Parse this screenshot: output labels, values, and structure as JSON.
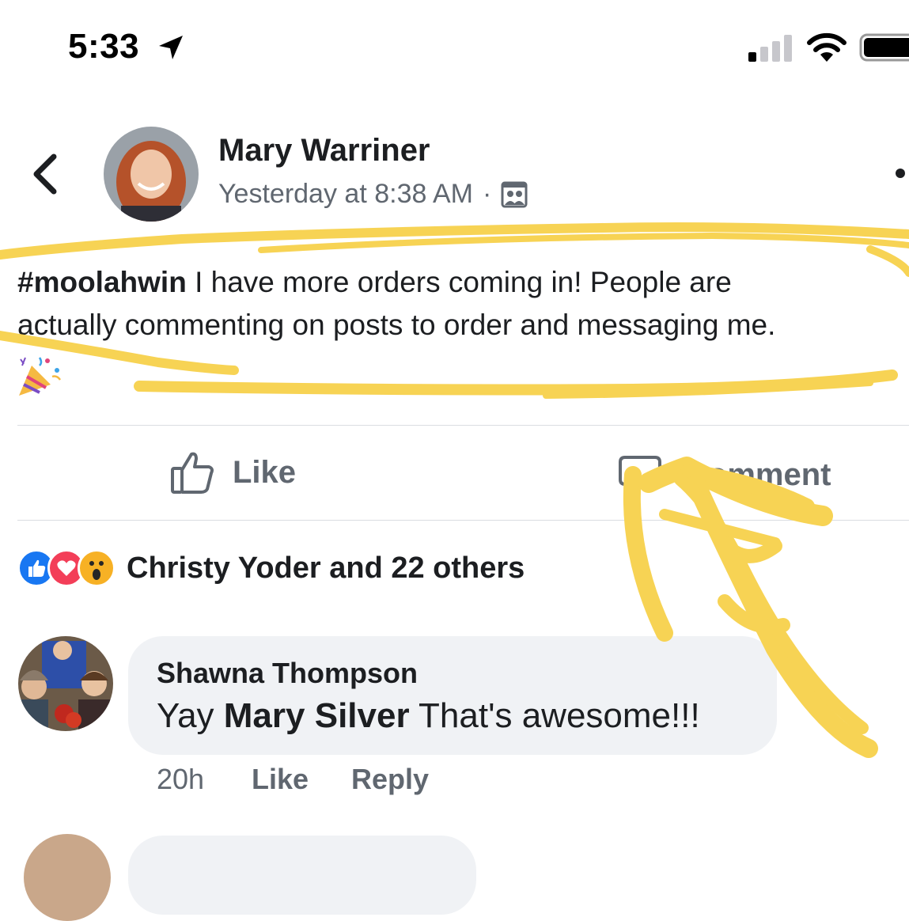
{
  "status_bar": {
    "time": "5:33",
    "icons": [
      "location-arrow-icon",
      "signal-icon",
      "wifi-icon",
      "battery-icon"
    ]
  },
  "post": {
    "author": "Mary Warriner",
    "timestamp": "Yesterday at 8:38 AM",
    "separator": "·",
    "audience_icon": "friends-icon",
    "hashtag": "#moolahwin",
    "text_line1": " I have more orders coming in! People are",
    "text_line2": "actually commenting on posts to order and messaging me.",
    "emoji_icon": "party-popper-icon"
  },
  "actions": {
    "like_label": "Like",
    "comment_label": "Comment"
  },
  "reactions": {
    "icons": [
      "like-reaction-icon",
      "love-reaction-icon",
      "wow-reaction-icon"
    ],
    "summary": "Christy Yoder and 22 others"
  },
  "comments": [
    {
      "author": "Shawna Thompson",
      "text_prefix": "Yay ",
      "mention": "Mary Silver",
      "text_suffix": " That's awesome!!!",
      "time": "20h",
      "like_label": "Like",
      "reply_label": "Reply"
    }
  ],
  "colors": {
    "annotation_yellow": "#f7d354",
    "secondary_text": "#606770",
    "bubble_bg": "#f0f2f5",
    "like_blue": "#1877f2",
    "love_red": "#f33e58",
    "wow_yellow": "#f7b125"
  }
}
